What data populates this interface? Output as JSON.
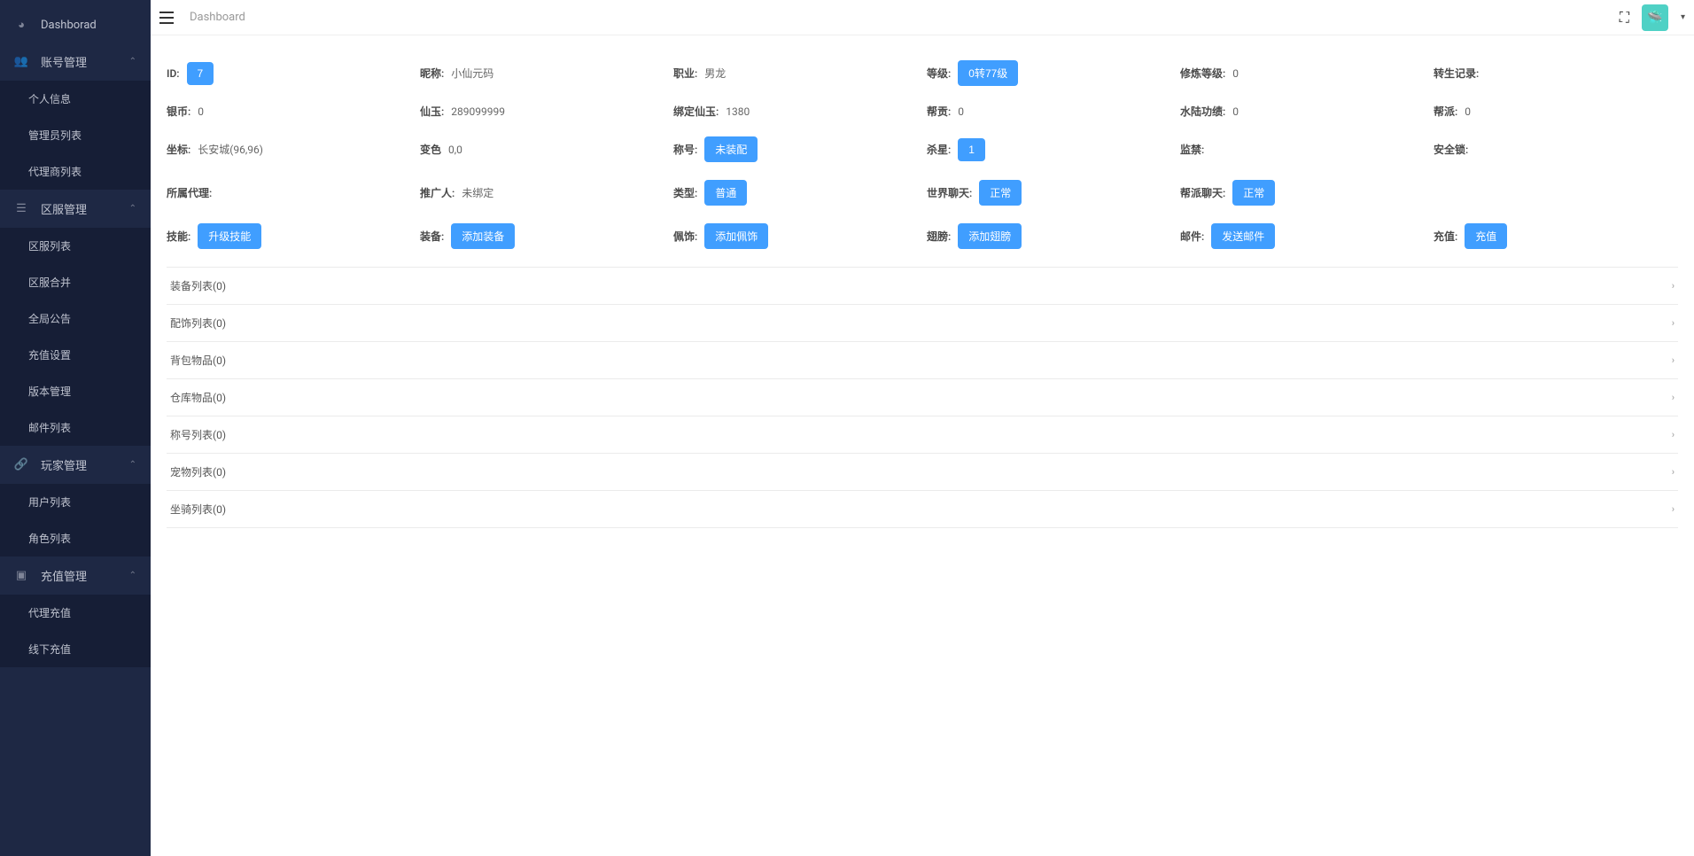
{
  "header": {
    "breadcrumb": "Dashboard"
  },
  "sidebar": {
    "dashboard": "Dashborad",
    "account_mgmt": "账号管理",
    "account_items": [
      "个人信息",
      "管理员列表",
      "代理商列表"
    ],
    "zone_mgmt": "区服管理",
    "zone_items": [
      "区服列表",
      "区服合并",
      "全局公告",
      "充值设置",
      "版本管理",
      "邮件列表"
    ],
    "player_mgmt": "玩家管理",
    "player_items": [
      "用户列表",
      "角色列表"
    ],
    "recharge_mgmt": "充值管理",
    "recharge_items": [
      "代理充值",
      "线下充值"
    ]
  },
  "info": {
    "row0": [
      {
        "label": "ID:",
        "button": "7"
      },
      {
        "label": "昵称:",
        "value": "小仙元码"
      },
      {
        "label": "职业:",
        "value": "男龙"
      },
      {
        "label": "等级:",
        "button": "0转77级"
      },
      {
        "label": "修炼等级:",
        "value": "0"
      },
      {
        "label": "转生记录:",
        "value": ""
      }
    ],
    "row1": [
      {
        "label": "银币:",
        "value": "0"
      },
      {
        "label": "仙玉:",
        "value": "289099999"
      },
      {
        "label": "绑定仙玉:",
        "value": "1380"
      },
      {
        "label": "帮贡:",
        "value": "0"
      },
      {
        "label": "水陆功绩:",
        "value": "0"
      },
      {
        "label": "帮派:",
        "value": "0"
      }
    ],
    "row2": [
      {
        "label": "坐标:",
        "value": "长安城(96,96)"
      },
      {
        "label": "变色",
        "value": "0,0"
      },
      {
        "label": "称号:",
        "button": "未装配"
      },
      {
        "label": "杀星:",
        "button": "1"
      },
      {
        "label": "监禁:",
        "value": ""
      },
      {
        "label": "安全锁:",
        "value": ""
      }
    ],
    "row3": [
      {
        "label": "所属代理:",
        "value": ""
      },
      {
        "label": "推广人:",
        "value": "未绑定"
      },
      {
        "label": "类型:",
        "button": "普通"
      },
      {
        "label": "世界聊天:",
        "button": "正常"
      },
      {
        "label": "帮派聊天:",
        "button": "正常"
      },
      {
        "label": "",
        "value": ""
      }
    ],
    "row4": [
      {
        "label": "技能:",
        "button": "升级技能"
      },
      {
        "label": "装备:",
        "button": "添加装备"
      },
      {
        "label": "佩饰:",
        "button": "添加佩饰"
      },
      {
        "label": "翅膀:",
        "button": "添加翅膀"
      },
      {
        "label": "邮件:",
        "button": "发送邮件"
      },
      {
        "label": "充值:",
        "button": "充值"
      }
    ]
  },
  "accordions": [
    "装备列表(0)",
    "配饰列表(0)",
    "背包物品(0)",
    "仓库物品(0)",
    "称号列表(0)",
    "宠物列表(0)",
    "坐骑列表(0)"
  ]
}
